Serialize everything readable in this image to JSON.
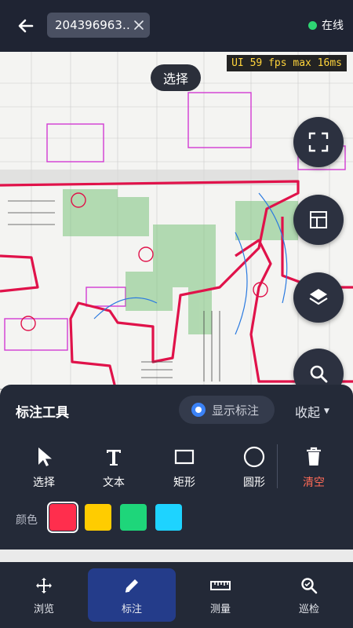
{
  "header": {
    "file_name": "204396963…",
    "status_text": "在线",
    "status_color": "#2ed573"
  },
  "overlay": {
    "fps_text": "UI 59 fps  max 16ms",
    "mode_label": "选择"
  },
  "fab_buttons": [
    {
      "icon": "fullscreen-icon"
    },
    {
      "icon": "layout-icon"
    },
    {
      "icon": "layers-icon"
    },
    {
      "icon": "search-icon"
    }
  ],
  "panel": {
    "title": "标注工具",
    "toggle_label": "显示标注",
    "collapse_label": "收起",
    "tools": [
      {
        "label": "选择",
        "icon": "cursor-icon"
      },
      {
        "label": "文本",
        "icon": "text-icon"
      },
      {
        "label": "矩形",
        "icon": "rectangle-icon"
      },
      {
        "label": "圆形",
        "icon": "circle-icon"
      },
      {
        "label": "清空",
        "icon": "trash-icon"
      }
    ],
    "color_label": "颜色",
    "colors": [
      "#ff2e4d",
      "#ffcc00",
      "#1ed67a",
      "#1ed3ff"
    ],
    "selected_color": "#ff2e4d"
  },
  "nav": {
    "items": [
      {
        "label": "浏览",
        "icon": "move-icon"
      },
      {
        "label": "标注",
        "icon": "pencil-icon",
        "active": true
      },
      {
        "label": "测量",
        "icon": "ruler-icon"
      },
      {
        "label": "巡检",
        "icon": "inspect-icon"
      }
    ]
  }
}
